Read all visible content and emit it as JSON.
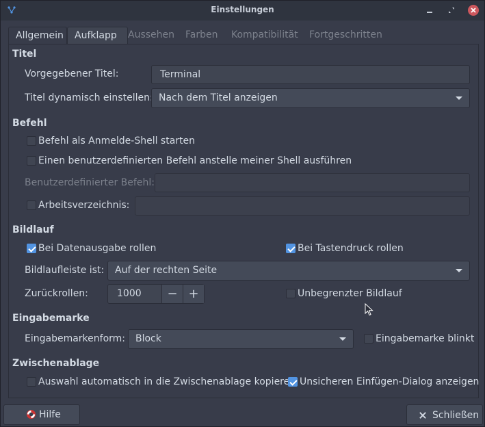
{
  "window": {
    "title": "Einstellungen",
    "controls": [
      "minimize-icon",
      "maximize-icon",
      "close-icon"
    ]
  },
  "tabs": [
    {
      "label": "Allgemein",
      "state": "active"
    },
    {
      "label": "Aufklapp",
      "state": "normal"
    },
    {
      "label": "Aussehen",
      "state": "normal"
    },
    {
      "label": "Farben",
      "state": "normal"
    },
    {
      "label": "Kompatibilität",
      "state": "normal"
    },
    {
      "label": "Fortgeschritten",
      "state": "normal"
    }
  ],
  "titel": {
    "heading": "Titel",
    "default_title_label": "Vorgegebener Titel:",
    "default_title_value": "Terminal",
    "dynamic_label": "Titel dynamisch einstellen:",
    "dynamic_value": "Nach dem Titel anzeigen"
  },
  "befehl": {
    "heading": "Befehl",
    "login_shell_label": "Befehl als Anmelde-Shell starten",
    "login_shell_checked": false,
    "custom_cmd_label": "Einen benutzerdefinierten Befehl anstelle meiner Shell ausführen",
    "custom_cmd_checked": false,
    "custom_cmd_field_label": "Benutzerdefinierter Befehl:",
    "custom_cmd_field_value": "",
    "workdir_label": "Arbeitsverzeichnis:",
    "workdir_checked": false,
    "workdir_value": ""
  },
  "bildlauf": {
    "heading": "Bildlauf",
    "scroll_output_label": "Bei Datenausgabe rollen",
    "scroll_output_checked": true,
    "scroll_key_label": "Bei Tastendruck rollen",
    "scroll_key_checked": true,
    "scrollbar_label": "Bildlaufleiste ist:",
    "scrollbar_value": "Auf der rechten Seite",
    "scrollback_label": "Zurückrollen:",
    "scrollback_value": "1000",
    "minus": "−",
    "plus": "+",
    "unlimited_label": "Unbegrenzter Bildlauf",
    "unlimited_checked": false
  },
  "eingabemarke": {
    "heading": "Eingabemarke",
    "shape_label": "Eingabemarkenform:",
    "shape_value": "Block",
    "blink_label": "Eingabemarke blinkt",
    "blink_checked": false
  },
  "zwischenablage": {
    "heading": "Zwischenablage",
    "auto_copy_label": "Auswahl automatisch in die Zwischenablage kopieren",
    "auto_copy_checked": false,
    "unsafe_paste_label": "Unsicheren Einfügen-Dialog anzeigen",
    "unsafe_paste_checked": true
  },
  "footer": {
    "help_label": "Hilfe",
    "help_icon": "lifebuoy-icon",
    "close_label": "Schließen",
    "close_icon": "close-icon"
  },
  "colors": {
    "accent": "#5294e2",
    "window_bg": "#383c4a",
    "titlebar_bg": "#2f343f",
    "close_button": "#cc575d"
  }
}
